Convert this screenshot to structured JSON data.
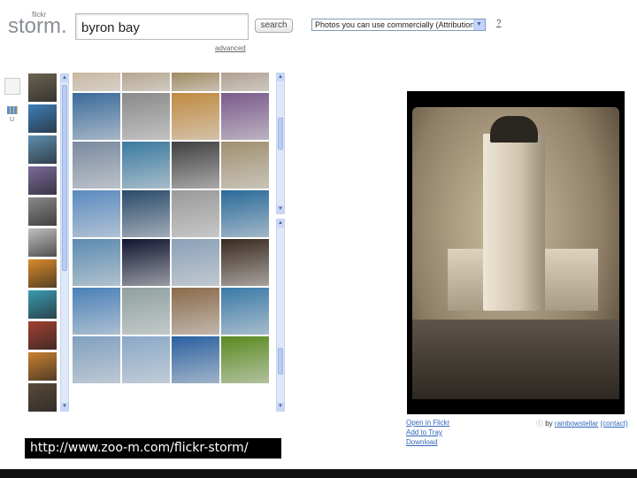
{
  "header": {
    "logo_small": "flickr",
    "logo": "storm.",
    "search_value": "byron bay",
    "search_button": "search",
    "advanced_link": "advanced",
    "license_select": "Photos you can use commercially (Attribution)",
    "help": "?"
  },
  "sidebar": {
    "grid_label": "U"
  },
  "photo_panel": {
    "links": [
      "Open in Flickr",
      "Add to Tray",
      "Download"
    ],
    "by_prefix": "by",
    "author": "rainbowstellar",
    "contact": "(contact)"
  },
  "banner": {
    "url": "http://www.zoo-m.com/flickr-storm/"
  },
  "thumb_colors": [
    "#6b6352",
    "#3d7fb8",
    "#5d8db0",
    "#7a6a9a",
    "#8a8a8a",
    "#c0c0c0",
    "#d98a2a",
    "#3a9ab0",
    "#a04030",
    "#c88030",
    "#5a4a3a"
  ],
  "grid_colors": [
    "#c9b8a0",
    "#b7a68e",
    "#a08a60",
    "#b0a090",
    "#3a6a9a",
    "#8a8a8a",
    "#c08a40",
    "#7a5a8a",
    "#7a8aa0",
    "#3a7aa0",
    "#404040",
    "#a09070",
    "#5a8ac0",
    "#2a4a6a",
    "#9a9a9a",
    "#2a6a9a",
    "#5a8ab0",
    "#101530",
    "#8aa0b8",
    "#3a2a20",
    "#4a80b8",
    "#90a0a0",
    "#8a6a4a",
    "#3a7aa8",
    "#80a0c0",
    "#8aa8c8",
    "#2a60a0",
    "#5a8a20"
  ]
}
